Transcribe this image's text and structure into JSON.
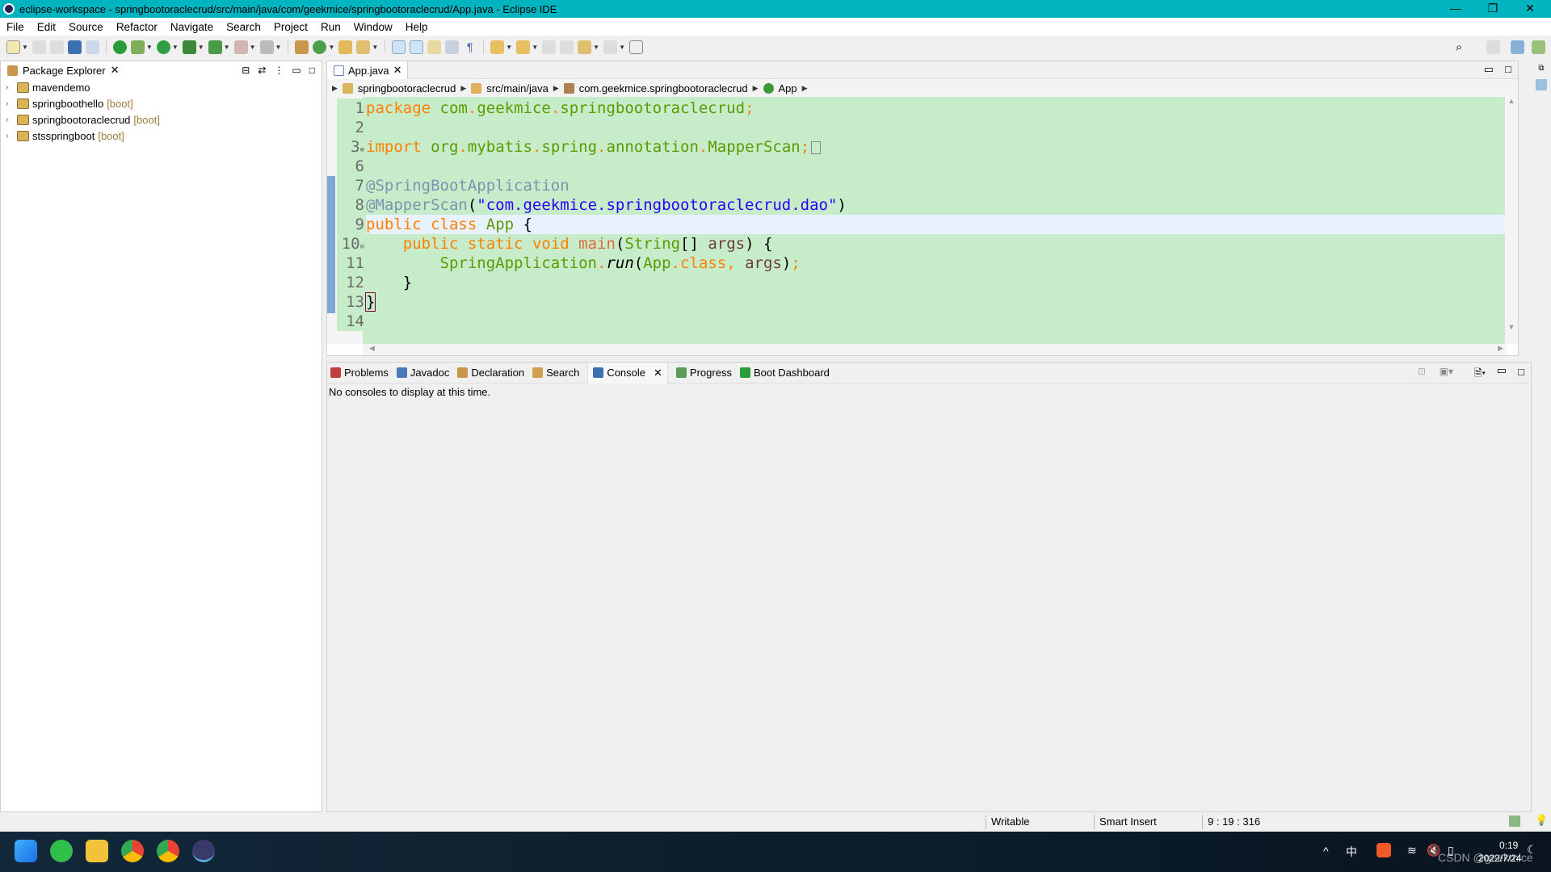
{
  "window": {
    "title": "eclipse-workspace - springbootoraclecrud/src/main/java/com/geekmice/springbootoraclecrud/App.java - Eclipse IDE",
    "minimize": "—",
    "restore": "❐",
    "close": "✕"
  },
  "menu": [
    "File",
    "Edit",
    "Source",
    "Refactor",
    "Navigate",
    "Search",
    "Project",
    "Run",
    "Window",
    "Help"
  ],
  "package_explorer": {
    "title": "Package Explorer",
    "close": "✕",
    "projects": [
      {
        "name": "mavendemo",
        "tag": ""
      },
      {
        "name": "springboothello",
        "tag": "[boot]"
      },
      {
        "name": "springbootoraclecrud",
        "tag": "[boot]"
      },
      {
        "name": "stsspringboot",
        "tag": "[boot]"
      }
    ]
  },
  "editor": {
    "tab": "App.java",
    "close": "✕",
    "breadcrumb": [
      "springbootoraclecrud",
      "src/main/java",
      "com.geekmice.springbootoraclecrud",
      "App"
    ],
    "lines": [
      {
        "n": "1",
        "tokens": [
          [
            "package",
            "kw"
          ],
          [
            " ",
            "pu"
          ],
          [
            "com",
            "id"
          ],
          [
            ".",
            "op"
          ],
          [
            "geekmice",
            "id"
          ],
          [
            ".",
            "op"
          ],
          [
            "springbootoraclecrud",
            "id"
          ],
          [
            ";",
            "op"
          ]
        ]
      },
      {
        "n": "2",
        "tokens": []
      },
      {
        "n": "3",
        "fold": "⊕",
        "tokens": [
          [
            "import",
            "kw"
          ],
          [
            " ",
            "pu"
          ],
          [
            "org",
            "id"
          ],
          [
            ".",
            "op"
          ],
          [
            "mybatis",
            "id"
          ],
          [
            ".",
            "op"
          ],
          [
            "spring",
            "id"
          ],
          [
            ".",
            "op"
          ],
          [
            "annotation",
            "id"
          ],
          [
            ".",
            "op"
          ],
          [
            "MapperScan",
            "id"
          ],
          [
            ";",
            "op"
          ]
        ]
      },
      {
        "n": "6",
        "tokens": []
      },
      {
        "n": "7",
        "tokens": [
          [
            "@SpringBootApplication",
            "an"
          ]
        ]
      },
      {
        "n": "8",
        "tokens": [
          [
            "@MapperScan",
            "an"
          ],
          [
            "(",
            "pu"
          ],
          [
            "\"com.geekmice.springbootoraclecrud.dao\"",
            "st"
          ],
          [
            ")",
            "pu"
          ]
        ]
      },
      {
        "n": "9",
        "current": true,
        "tokens": [
          [
            "public",
            "kw"
          ],
          [
            " ",
            "pu"
          ],
          [
            "class",
            "kw"
          ],
          [
            " ",
            "pu"
          ],
          [
            "App",
            "id"
          ],
          [
            " {",
            "pu"
          ]
        ]
      },
      {
        "n": "10",
        "fold": "⊖",
        "tokens": [
          [
            "    ",
            "pu"
          ],
          [
            "public",
            "kw"
          ],
          [
            " ",
            "pu"
          ],
          [
            "static",
            "kw"
          ],
          [
            " ",
            "pu"
          ],
          [
            "void",
            "kw"
          ],
          [
            " ",
            "pu"
          ],
          [
            "main",
            "me"
          ],
          [
            "(",
            "pu"
          ],
          [
            "String",
            "id"
          ],
          [
            "[] ",
            "pu"
          ],
          [
            "args",
            "ar"
          ],
          [
            ") {",
            "pu"
          ]
        ]
      },
      {
        "n": "11",
        "tokens": [
          [
            "        ",
            "pu"
          ],
          [
            "SpringApplication",
            "id"
          ],
          [
            ".",
            "op"
          ],
          [
            "run",
            "it"
          ],
          [
            "(",
            "pu"
          ],
          [
            "App",
            "id"
          ],
          [
            ".",
            "op"
          ],
          [
            "class",
            "kw"
          ],
          [
            ",",
            "op"
          ],
          [
            " ",
            "pu"
          ],
          [
            "args",
            "ar"
          ],
          [
            ")",
            "pu"
          ],
          [
            ";",
            "op"
          ]
        ]
      },
      {
        "n": "12",
        "tokens": [
          [
            "    }",
            "pu"
          ]
        ]
      },
      {
        "n": "13",
        "tokens": [
          [
            "}",
            "pu"
          ]
        ]
      },
      {
        "n": "14",
        "tokens": []
      }
    ]
  },
  "bottom_panel": {
    "tabs": [
      "Problems",
      "Javadoc",
      "Declaration",
      "Search",
      "Console",
      "Progress",
      "Boot Dashboard"
    ],
    "active": "Console",
    "close": "✕",
    "message": "No consoles to display at this time."
  },
  "status": {
    "mode": "Writable",
    "insert": "Smart Insert",
    "position": "9 : 19 : 316"
  },
  "taskbar": {
    "ime": "中",
    "time": "0:19",
    "date": "2022/7/24",
    "watermark": "CSDN @geekmice"
  },
  "colors": {
    "titlebar": "#00b4c0",
    "editor_bg": "#c7ecc9",
    "current_line": "#e8f2fe",
    "keyword": "#ff7f00",
    "identifier": "#5e9a00",
    "annotation": "#7e93b0",
    "string": "#2a00ff"
  }
}
